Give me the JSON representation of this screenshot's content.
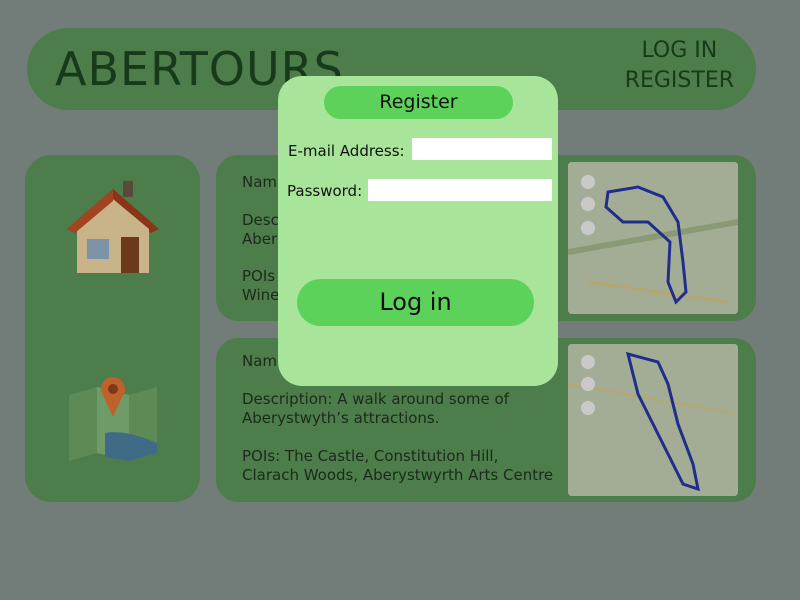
{
  "header": {
    "logo": "ABERTOURS",
    "login_link": "LOG IN",
    "register_link": "REGISTER"
  },
  "tours": [
    {
      "name_label": "Nam",
      "desc_line1": "Desc",
      "desc_line2": "Aber",
      "pois_line1": "POIs",
      "pois_line2": "Wine"
    },
    {
      "name_label": "Name",
      "desc_line1": "Description: A walk around some of",
      "desc_line2": "Aberystwyth’s attractions.",
      "pois_line1": "POIs: The Castle, Constitution Hill,",
      "pois_line2": "Clarach Woods, Aberystwyrth Arts Centre"
    }
  ],
  "modal": {
    "title": "Register",
    "email_label": "E-mail Address:",
    "email_value": "",
    "password_label": "Password:",
    "password_value": "",
    "submit_label": "Log in"
  },
  "icons": {
    "home": "home-icon",
    "map": "map-icon",
    "route_map_1": "route-map-image",
    "route_map_2": "route-map-image"
  }
}
